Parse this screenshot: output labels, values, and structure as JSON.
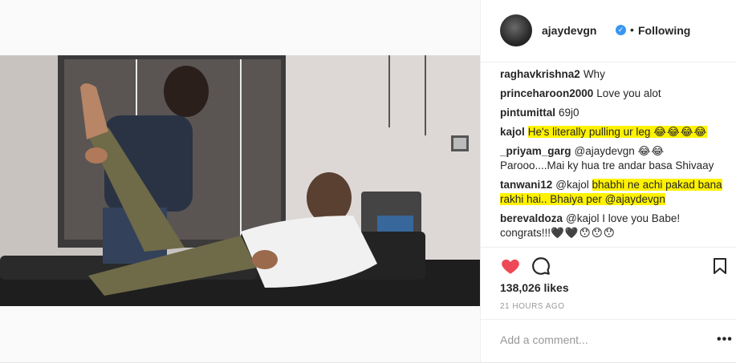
{
  "post": {
    "username": "ajaydevgn",
    "verified_icon": "verified-badge-icon",
    "separator": "•",
    "follow_status": "Following",
    "photo_icon": "post-photo",
    "comments": [
      {
        "user": "raghavkrishna2",
        "text": "Why"
      },
      {
        "user": "princeharoon2000",
        "text": "Love you alot"
      },
      {
        "user": "pintumittal",
        "text": "69j0"
      },
      {
        "user": "kajol",
        "text": "He's literally pulling ur leg",
        "emoji": "😂😂😂😂"
      },
      {
        "user": "_priyam_garg",
        "text": "@ajaydevgn",
        "emoji": "😂😂",
        "text2": "Parooo....Mai ky hua tre andar basa Shivaay"
      },
      {
        "user": "tanwani12",
        "text": "@kajol",
        "text_hl": "bhabhi ne achi pakad bana rakhi hai.. Bhaiya per @ajaydevgn"
      },
      {
        "user": "berevaldoza",
        "text": "@kajol I love you Babe! congrats!!!",
        "emoji": "🖤🖤😯😯😯"
      }
    ],
    "likes": "138,026 likes",
    "time": "21 HOURS AGO",
    "comment_placeholder": "Add a comment...",
    "more_label": "•••",
    "colors": {
      "like_red": "#ed4956",
      "verified_blue": "#3897f0",
      "highlight": "#fff200"
    }
  }
}
